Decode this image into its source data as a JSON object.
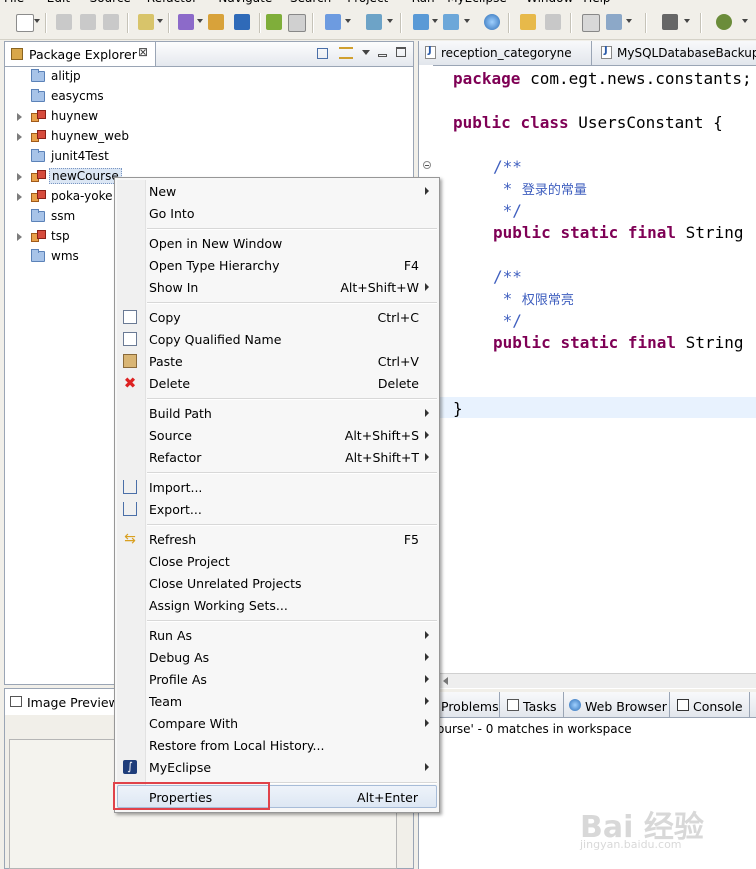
{
  "menubar": {
    "items": [
      "File",
      "Edit",
      "Source",
      "Refactor",
      "Navigate",
      "Search",
      "Project",
      "Run",
      "MyEclipse",
      "Window",
      "Help"
    ]
  },
  "package_explorer": {
    "title": "Package Explorer",
    "close_glyph": "⊠",
    "items": [
      {
        "label": "alitjp",
        "type": "folder",
        "expandable": false
      },
      {
        "label": "easycms",
        "type": "folder",
        "expandable": false
      },
      {
        "label": "huynew",
        "type": "project",
        "expandable": true
      },
      {
        "label": "huynew_web",
        "type": "project",
        "expandable": true
      },
      {
        "label": "junit4Test",
        "type": "folder",
        "expandable": false
      },
      {
        "label": "newCourse",
        "type": "project",
        "expandable": true,
        "selected": true
      },
      {
        "label": "poka-yoke",
        "type": "project",
        "expandable": true
      },
      {
        "label": "ssm",
        "type": "folder",
        "expandable": false
      },
      {
        "label": "tsp",
        "type": "project",
        "expandable": true
      },
      {
        "label": "wms",
        "type": "folder",
        "expandable": false
      }
    ]
  },
  "image_preview": {
    "title": "Image Preview"
  },
  "editor": {
    "tabs": [
      {
        "label": "reception_categoryne"
      },
      {
        "label": "MySQLDatabaseBackup"
      }
    ],
    "code": {
      "package_kw": "package",
      "package_name": " com.egt.news.constants;",
      "public_kw": "public",
      "class_kw": "class",
      "class_name": " UsersConstant {",
      "doc_open": "/**",
      "doc_star": " * ",
      "doc_close": " */",
      "comment1": "登录的常量",
      "comment2": "权限常亮",
      "static_kw": "static",
      "final_kw": "final",
      "string_type": " String",
      "closing_brace": "}"
    }
  },
  "bottom_views": {
    "tabs": [
      {
        "label": "Problems"
      },
      {
        "label": "Tasks"
      },
      {
        "label": "Web Browser"
      },
      {
        "label": "Console"
      }
    ],
    "search_result": "ourse' - 0 matches in workspace"
  },
  "context_menu": {
    "groups": [
      [
        {
          "label": "New",
          "accel": "",
          "submenu": true,
          "icon": ""
        },
        {
          "label": "Go Into",
          "accel": "",
          "submenu": false,
          "icon": ""
        }
      ],
      [
        {
          "label": "Open in New Window",
          "accel": "",
          "submenu": false,
          "icon": ""
        },
        {
          "label": "Open Type Hierarchy",
          "accel": "F4",
          "submenu": false,
          "icon": ""
        },
        {
          "label": "Show In",
          "accel": "Alt+Shift+W",
          "submenu": true,
          "icon": ""
        }
      ],
      [
        {
          "label": "Copy",
          "accel": "Ctrl+C",
          "submenu": false,
          "icon": "copy-icon"
        },
        {
          "label": "Copy Qualified Name",
          "accel": "",
          "submenu": false,
          "icon": "copy-qualified-icon"
        },
        {
          "label": "Paste",
          "accel": "Ctrl+V",
          "submenu": false,
          "icon": "paste-icon"
        },
        {
          "label": "Delete",
          "accel": "Delete",
          "submenu": false,
          "icon": "delete-icon"
        }
      ],
      [
        {
          "label": "Build Path",
          "accel": "",
          "submenu": true,
          "icon": ""
        },
        {
          "label": "Source",
          "accel": "Alt+Shift+S",
          "submenu": true,
          "icon": ""
        },
        {
          "label": "Refactor",
          "accel": "Alt+Shift+T",
          "submenu": true,
          "icon": ""
        }
      ],
      [
        {
          "label": "Import...",
          "accel": "",
          "submenu": false,
          "icon": "import-icon"
        },
        {
          "label": "Export...",
          "accel": "",
          "submenu": false,
          "icon": "export-icon"
        }
      ],
      [
        {
          "label": "Refresh",
          "accel": "F5",
          "submenu": false,
          "icon": "refresh-icon"
        },
        {
          "label": "Close Project",
          "accel": "",
          "submenu": false,
          "icon": ""
        },
        {
          "label": "Close Unrelated Projects",
          "accel": "",
          "submenu": false,
          "icon": ""
        },
        {
          "label": "Assign Working Sets...",
          "accel": "",
          "submenu": false,
          "icon": ""
        }
      ],
      [
        {
          "label": "Run As",
          "accel": "",
          "submenu": true,
          "icon": ""
        },
        {
          "label": "Debug As",
          "accel": "",
          "submenu": true,
          "icon": ""
        },
        {
          "label": "Profile As",
          "accel": "",
          "submenu": true,
          "icon": ""
        },
        {
          "label": "Team",
          "accel": "",
          "submenu": true,
          "icon": ""
        },
        {
          "label": "Compare With",
          "accel": "",
          "submenu": true,
          "icon": ""
        },
        {
          "label": "Restore from Local History...",
          "accel": "",
          "submenu": false,
          "icon": ""
        },
        {
          "label": "MyEclipse",
          "accel": "",
          "submenu": true,
          "icon": "myeclipse-icon"
        }
      ],
      [
        {
          "label": "Properties",
          "accel": "Alt+Enter",
          "submenu": false,
          "icon": "",
          "hot": true
        }
      ]
    ]
  },
  "watermark": {
    "text": "Bai 经验",
    "sub": "jingyan.baidu.com"
  },
  "colors": {
    "keyword": "#7f0055",
    "comment": "#3f5fbf",
    "highlight_box": "#e0424a",
    "selection": "#dbe6f4"
  }
}
